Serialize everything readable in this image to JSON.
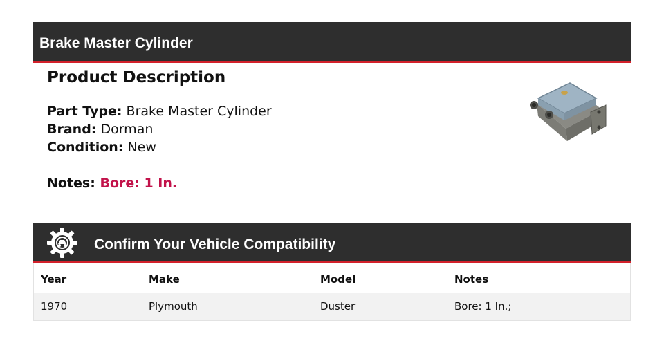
{
  "header": {
    "title": "Brake Master Cylinder"
  },
  "description": {
    "heading": "Product Description",
    "specs": [
      {
        "label": "Part Type:",
        "value": "Brake Master Cylinder"
      },
      {
        "label": "Brand:",
        "value": "Dorman"
      },
      {
        "label": "Condition:",
        "value": "New"
      }
    ],
    "notes": {
      "label": "Notes:",
      "value": "Bore: 1 In."
    }
  },
  "product_image": {
    "icon": "brake-master-cylinder-image"
  },
  "compatibility": {
    "icon": "gear-vehicle-icon",
    "title": "Confirm Your Vehicle Compatibility",
    "columns": [
      "Year",
      "Make",
      "Model",
      "Notes"
    ],
    "rows": [
      {
        "year": "1970",
        "make": "Plymouth",
        "model": "Duster",
        "notes": "Bore: 1 In.;"
      }
    ]
  },
  "colors": {
    "bar": "#2e2e2e",
    "accent": "#d3212b",
    "notes": "#c2124a",
    "row_bg": "#f2f2f2"
  }
}
